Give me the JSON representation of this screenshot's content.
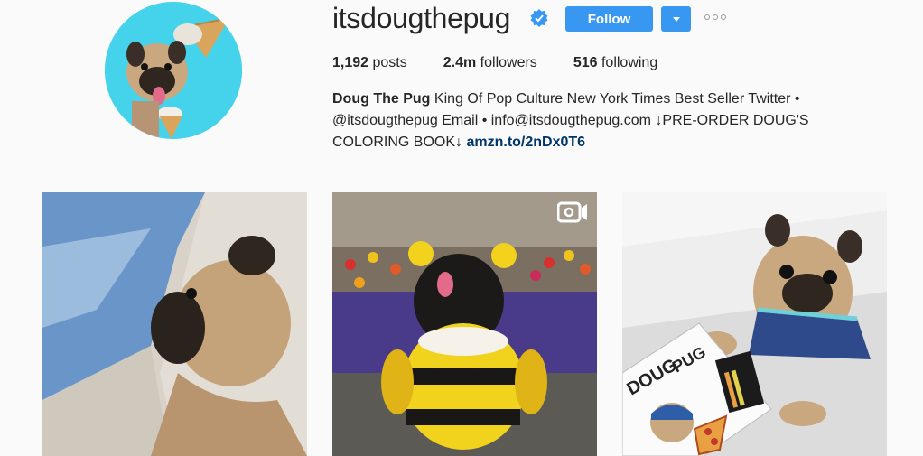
{
  "profile": {
    "username": "itsdougthepug",
    "follow_label": "Follow",
    "posts_count": "1,192",
    "posts_label": "posts",
    "followers_count": "2.4m",
    "followers_label": "followers",
    "following_count": "516",
    "following_label": "following",
    "bio_name": "Doug The Pug",
    "bio_text_1": "King Of Pop Culture New York Times Best Seller Twitter •",
    "bio_handle": "@itsdougthepug",
    "bio_text_2": "Email • info@itsdougthepug.com ↓PRE-ORDER DOUG'S",
    "bio_text_3": "COLORING BOOK↓",
    "bio_link": "amzn.to/2nDx0T6"
  },
  "colors": {
    "accent": "#3897f0",
    "link": "#003569"
  },
  "posts": [
    {
      "label": "pug in airplane window",
      "type": "photo"
    },
    {
      "label": "pug in bee costume",
      "type": "video"
    },
    {
      "label": "pug with coloring book",
      "type": "photo"
    }
  ]
}
